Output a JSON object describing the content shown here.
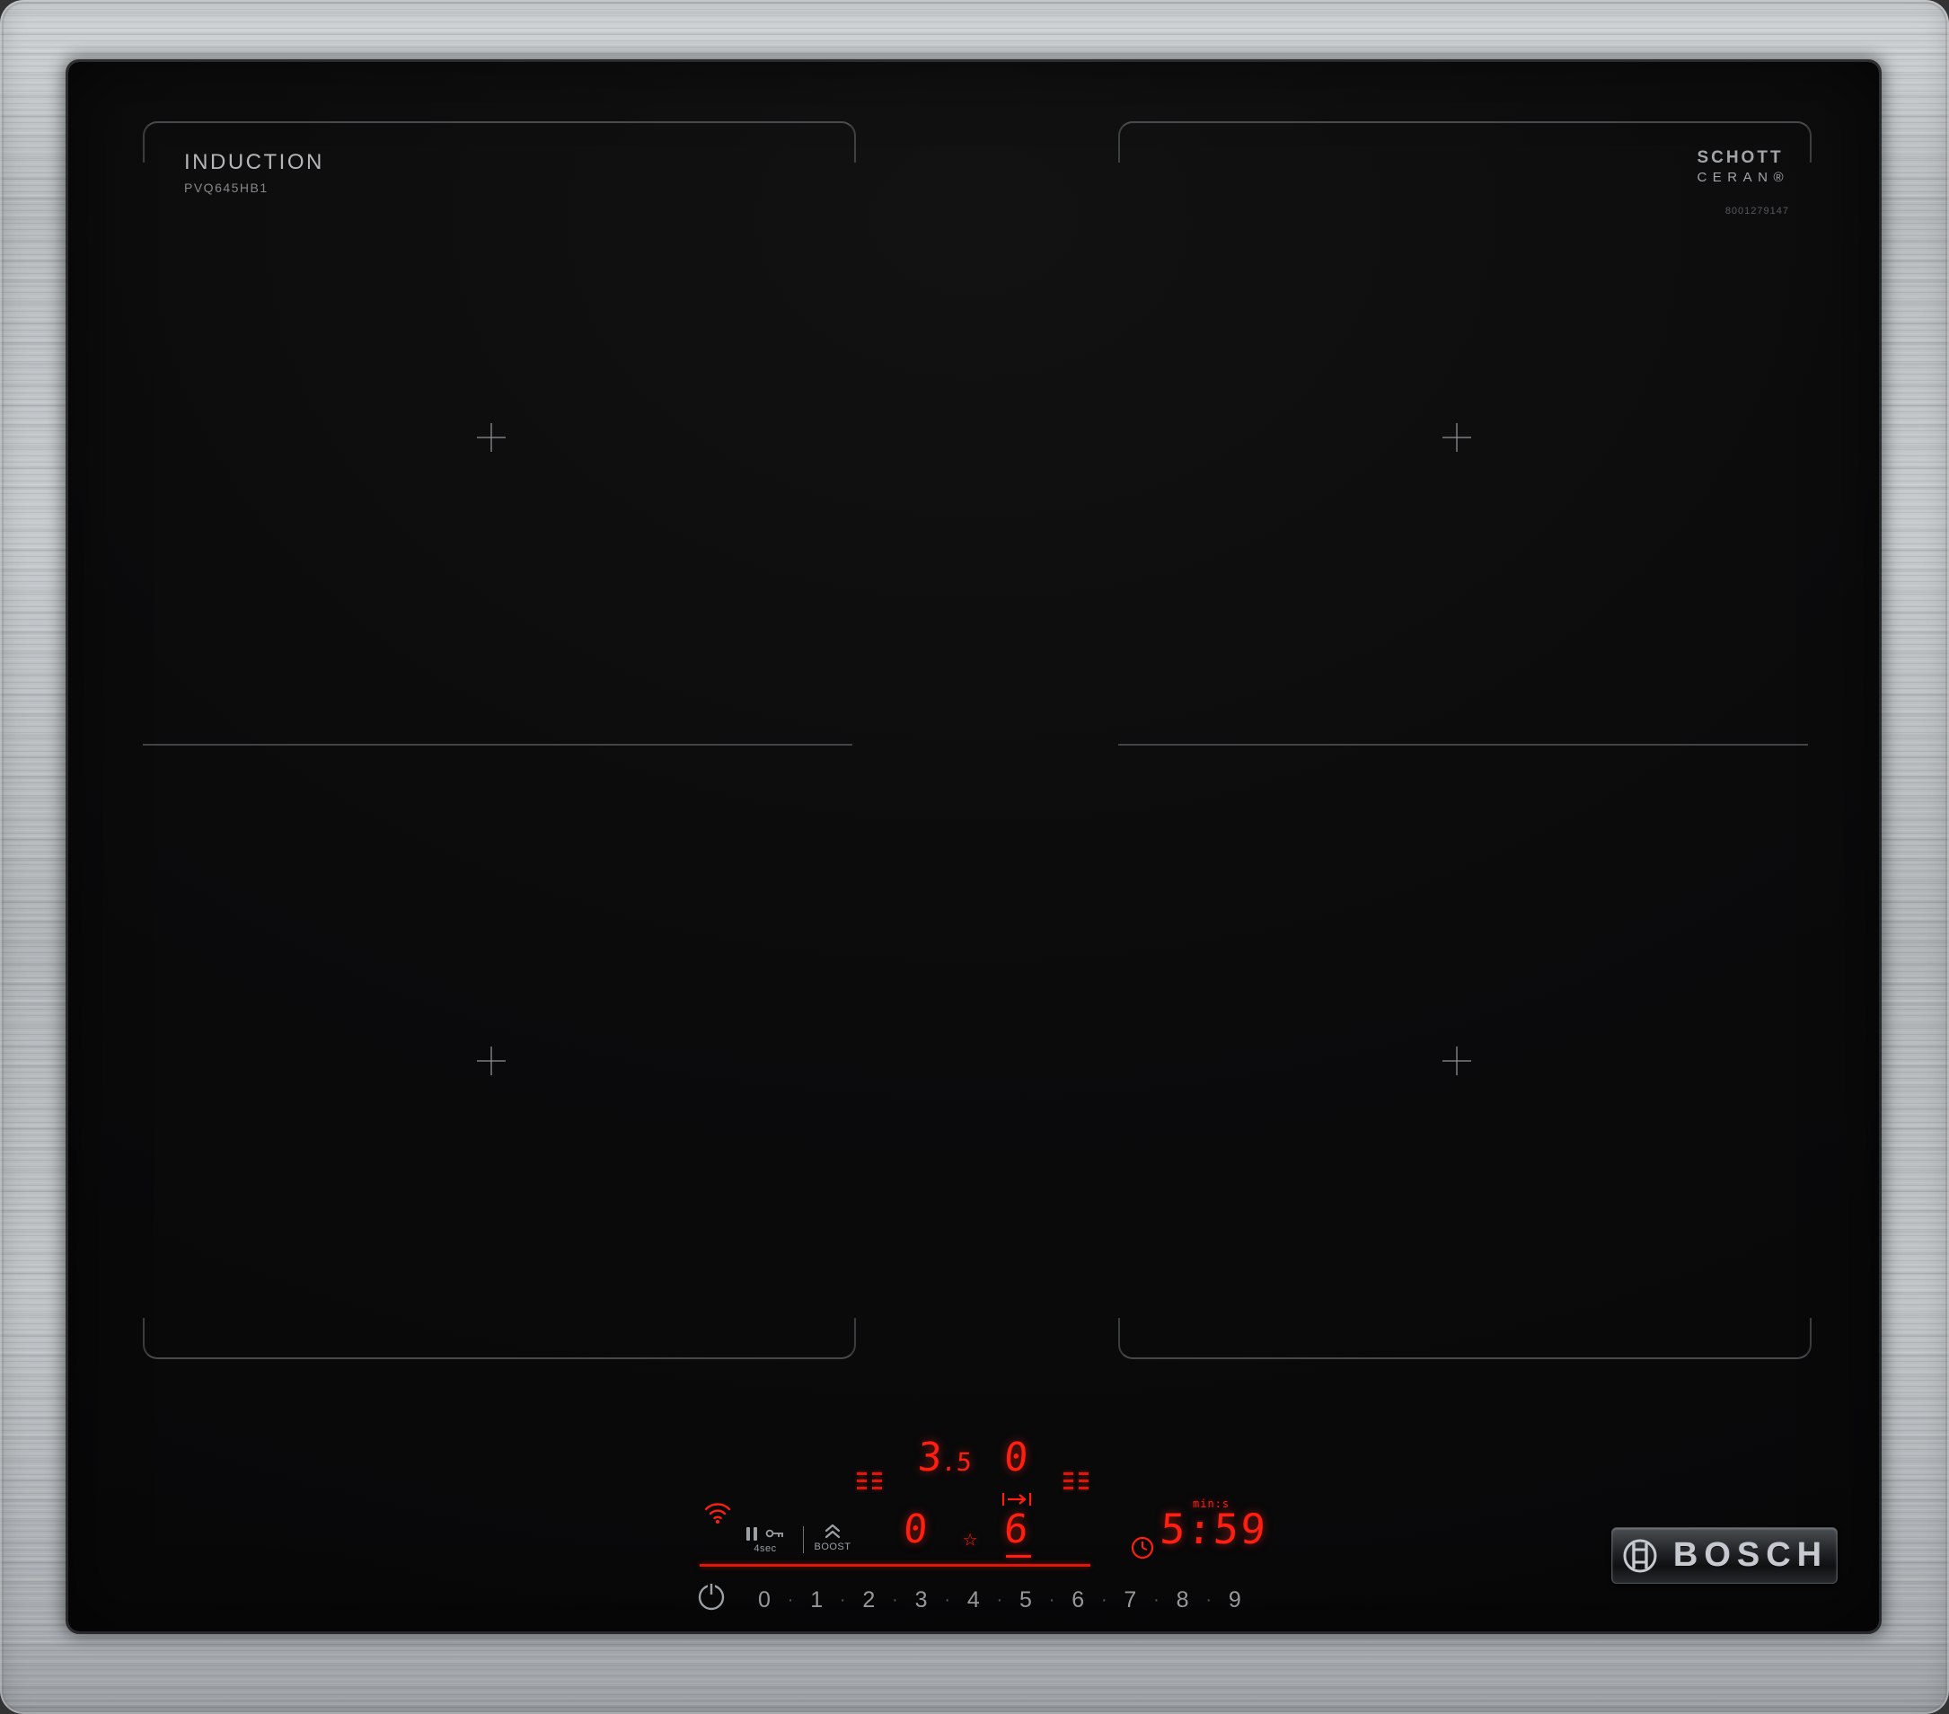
{
  "device": {
    "type_label": "INDUCTION",
    "model": "PVQ645HB1",
    "glass_brand": {
      "line1": "SCHOTT",
      "line2": "CERAN®",
      "part_number": "8001279147"
    },
    "logo_text": "BOSCH"
  },
  "control_panel": {
    "pause_lock": {
      "hold_label": "4sec"
    },
    "boost": {
      "label": "BOOST"
    },
    "zone_displays": {
      "rear_left_main": "3",
      "rear_left_frac": ".5",
      "rear_right": "0",
      "front_left": "0",
      "front_right": "6"
    },
    "favorite_icon_char": "☆",
    "timer": {
      "unit_label": "min:s",
      "value": "5:59"
    },
    "power_slider": {
      "separator": "·",
      "numbers": [
        "0",
        "1",
        "2",
        "3",
        "4",
        "5",
        "6",
        "7",
        "8",
        "9"
      ]
    }
  },
  "colors": {
    "led_red": "#ff1e10",
    "icon_gray": "#9aa0a4",
    "zone_mark": "#63676b"
  }
}
